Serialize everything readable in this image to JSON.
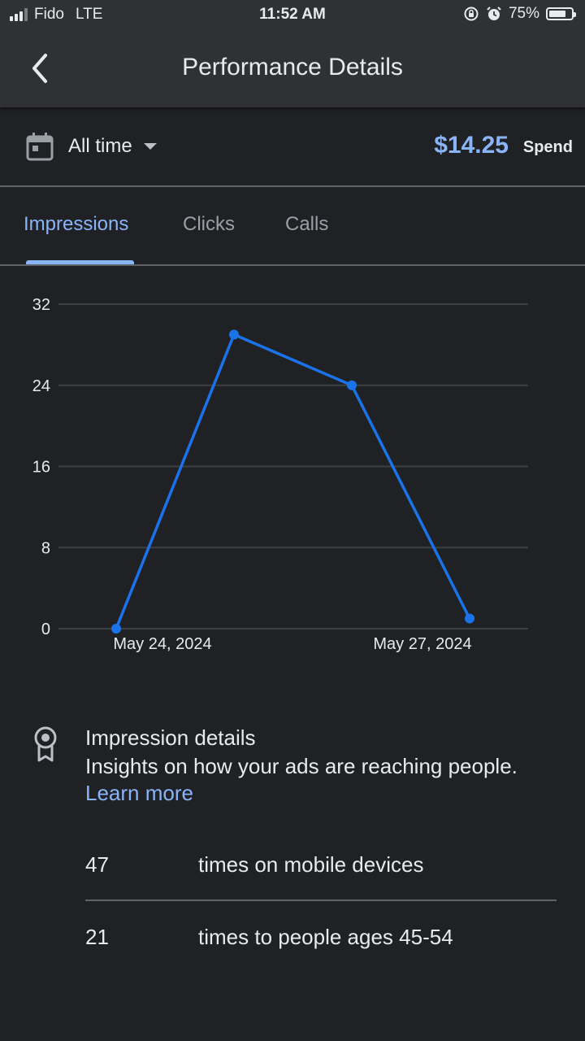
{
  "status_bar": {
    "carrier": "Fido",
    "network": "LTE",
    "time": "11:52 AM",
    "battery_percent": "75%",
    "battery_level": 0.75
  },
  "app_bar": {
    "title": "Performance Details",
    "back_icon": "chevron-left-icon"
  },
  "filter": {
    "calendar_icon": "calendar-icon",
    "range_label": "All time",
    "spend_amount": "$14.25",
    "spend_label": "Spend"
  },
  "tabs": [
    {
      "label": "Impressions",
      "active": true
    },
    {
      "label": "Clicks",
      "active": false
    },
    {
      "label": "Calls",
      "active": false
    }
  ],
  "chart_data": {
    "type": "line",
    "y_ticks": [
      "32",
      "24",
      "16",
      "8",
      "0"
    ],
    "x_tick_labels": [
      "May 24, 2024",
      "May 27, 2024"
    ],
    "ylim": [
      0,
      32
    ],
    "x": [
      "2024-05-24",
      "2024-05-25",
      "2024-05-26",
      "2024-05-27"
    ],
    "series": [
      {
        "values": [
          0,
          29,
          24,
          1
        ]
      }
    ],
    "grid": true,
    "color": "#1a73e8"
  },
  "details": {
    "icon": "ribbon-icon",
    "title": "Impression details",
    "description": "Insights on how your ads are reaching people.",
    "learn_more": "Learn more",
    "stats": [
      {
        "value": "47",
        "label": "times on mobile devices"
      },
      {
        "value": "21",
        "label": "times to people ages 45-54"
      }
    ]
  },
  "colors": {
    "background": "#202124",
    "surface": "#303134",
    "accent": "#8ab4f8",
    "line": "#1a73e8"
  }
}
